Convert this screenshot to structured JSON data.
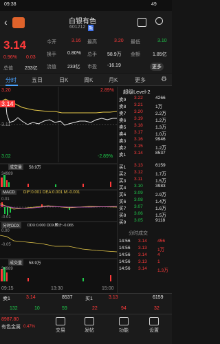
{
  "status": {
    "time": "09:38",
    "battery": "49"
  },
  "header": {
    "title": "白银有色",
    "code": "601212",
    "code_badge": "融"
  },
  "quote": {
    "price": "3.14",
    "pct": "0.96%",
    "chg": "0.03",
    "r1": [
      [
        "今开",
        "3.16"
      ],
      [
        "最高",
        "3.20"
      ],
      [
        "最低",
        "3.10"
      ]
    ],
    "r2": [
      [
        "换手",
        "0.80%"
      ],
      [
        "总手",
        "58.9万"
      ],
      [
        "金额",
        "1.85亿"
      ]
    ],
    "r3": [
      [
        "总值",
        "233亿"
      ],
      [
        "流值",
        "233亿"
      ],
      [
        "市盈",
        "-16.19"
      ]
    ],
    "more": "更多"
  },
  "tabs": [
    "分时",
    "五日",
    "日K",
    "周K",
    "月K",
    "更多"
  ],
  "chart": {
    "price_top": "3.20",
    "pct_top": "2.89%",
    "price_mid": "3.11",
    "price_bot": "3.02",
    "pct_bot": "-2.89%",
    "vol_label": "成交量",
    "vol_value": "58.9万",
    "vol_scale": "34989",
    "macd_label": "MACD",
    "macd_vals": "DIF:0.001 DEA:0.001 M:-0.001",
    "macd_top": "0.01",
    "macd_bot": "-0.01",
    "ddx_label": "分时DDX",
    "ddx_vals": "DDX:0.000 DDX累计:-0.065",
    "ddx_top": "0.00",
    "ddx_bot": "-0.05",
    "vol2_label": "成交量",
    "vol2_value": "58.9万",
    "vol2_scale": "34989",
    "t_start": "09:15",
    "t_mid": "13:30",
    "t_end": "15:00"
  },
  "book": {
    "level": "超级Level-2",
    "sells": [
      [
        "卖9",
        "3.22",
        "4266"
      ],
      [
        "卖8",
        "3.21",
        "1万"
      ],
      [
        "卖7",
        "3.20",
        "2.2万"
      ],
      [
        "卖6",
        "3.19",
        "1.2万"
      ],
      [
        "卖5",
        "3.18",
        "1.3万"
      ],
      [
        "卖4",
        "3.17",
        "1.0万"
      ],
      [
        "卖3",
        "3.16",
        "9946"
      ],
      [
        "卖2",
        "3.15",
        "1.2万"
      ],
      [
        "卖1",
        "3.14",
        "8537"
      ]
    ],
    "buys": [
      [
        "买1",
        "3.13",
        "6159"
      ],
      [
        "买2",
        "3.12",
        "1.7万"
      ],
      [
        "买3",
        "3.11",
        "1.5万"
      ],
      [
        "买4",
        "3.10",
        "3983"
      ],
      [
        "买5",
        "3.09",
        "2.9万"
      ],
      [
        "买6",
        "3.08",
        "1.4万"
      ],
      [
        "买7",
        "3.07",
        "1.6万"
      ],
      [
        "买8",
        "3.06",
        "1.5万"
      ],
      [
        "买9",
        "3.05",
        "9118"
      ]
    ],
    "ticks_title": "分时成交",
    "ticks": [
      [
        "14:56",
        "3.14",
        "456"
      ],
      [
        "14:56",
        "3.13",
        "1万"
      ],
      [
        "14:56",
        "3.14",
        "4"
      ],
      [
        "14:56",
        "3.13",
        "1"
      ],
      [
        "14:56",
        "3.14",
        "1.3万"
      ]
    ]
  },
  "trade": {
    "sell_label": "卖1",
    "sell_price": "3.14",
    "sell_vol": "8537",
    "buy_label": "买1",
    "buy_price": "3.13",
    "buy_vol": "6159",
    "counts": [
      "132",
      "10",
      "59",
      "22",
      "94",
      "32"
    ]
  },
  "bottom": {
    "index_value": "8987.80",
    "index_name": "有色金属",
    "index_pct": "0.47%",
    "items": [
      "交易",
      "发帖",
      "功能",
      "设置"
    ]
  }
}
